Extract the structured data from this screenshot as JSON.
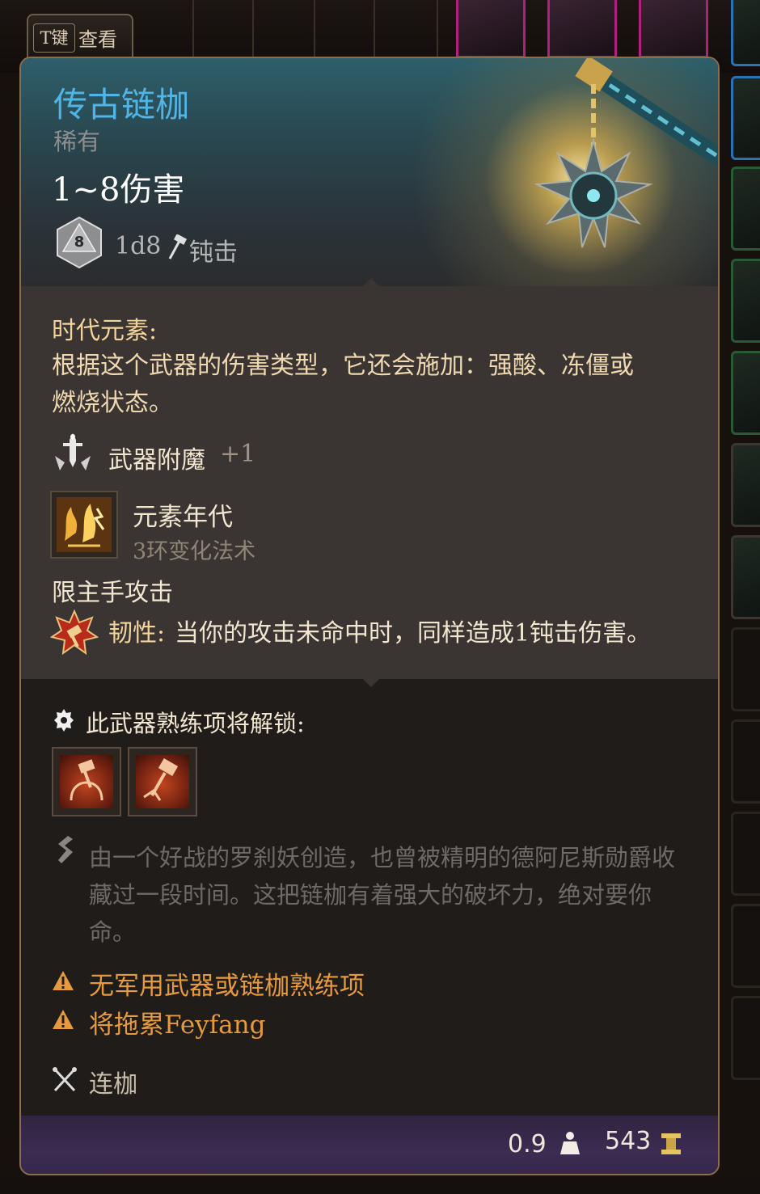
{
  "view_tab": {
    "key": "T键",
    "label": "查看"
  },
  "item": {
    "name": "传古链枷",
    "rarity": "稀有",
    "damage": "1~8伤害",
    "die_face": "8",
    "dice": "1d8",
    "damage_type": "钝击",
    "name_color": "#4fb5e6"
  },
  "enchant": {
    "title": "时代元素:",
    "description": "根据这个武器的伤害类型，它还会施加：强酸、冻僵或燃烧状态。"
  },
  "boost": {
    "label": "武器附魔",
    "value": "+1",
    "icon": "sword-enchant-icon"
  },
  "spell": {
    "name": "元素年代",
    "subtitle": "3环变化法术",
    "icon": "elemental-spell-icon"
  },
  "mainhand": "限主手攻击",
  "toughness": {
    "label": "韧性:",
    "text": "当你的攻击未命中时，同样造成1钝击伤害。",
    "icon": "toughness-icon"
  },
  "proficiency": {
    "title": "此武器熟练项将解锁:",
    "actions": [
      {
        "icon": "brace-action-icon"
      },
      {
        "icon": "smash-action-icon"
      }
    ]
  },
  "lore": "由一个好战的罗刹妖创造，也曾被精明的德阿尼斯勋爵收藏过一段时间。这把链枷有着强大的破坏力，绝对要你命。",
  "warnings": [
    "无军用武器或链枷熟练项",
    "将拖累Feyfang"
  ],
  "weapon_type": "连枷",
  "footer": {
    "weight": "0.9",
    "price": "543"
  },
  "colors": {
    "warning": "#e69a3e",
    "rarity_gray": "#8e8e8e",
    "footer_purple": "#3c2c52"
  }
}
